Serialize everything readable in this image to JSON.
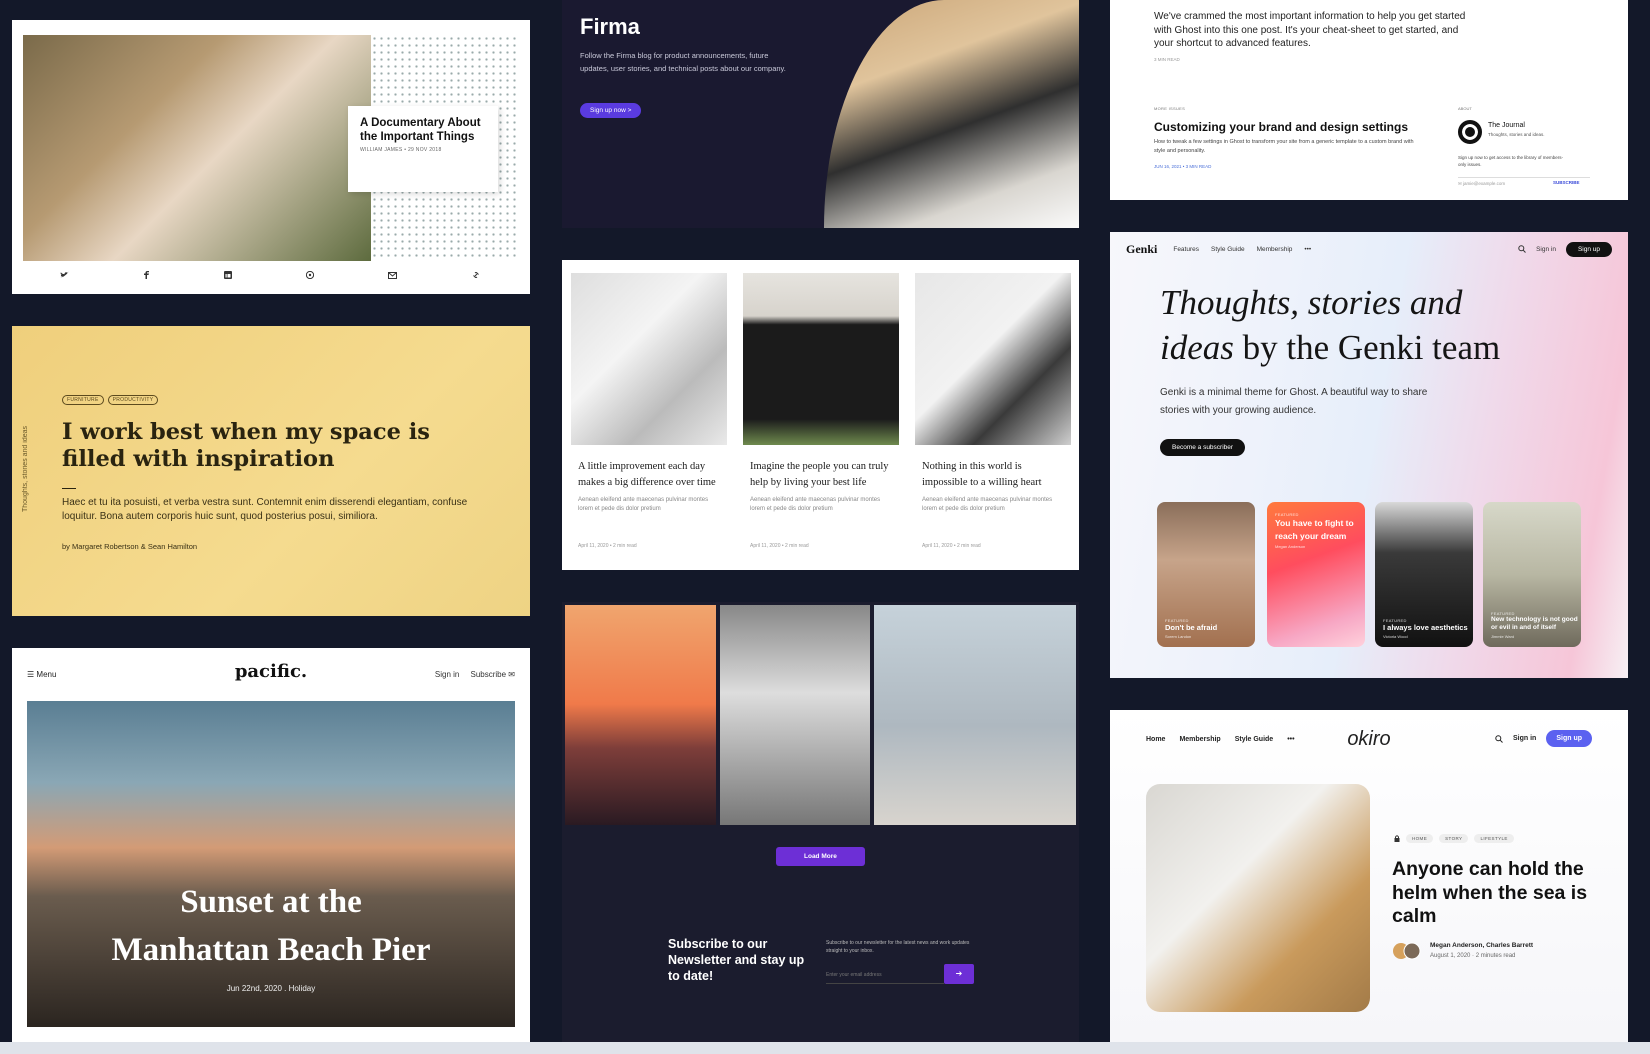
{
  "card1": {
    "title": "A Documentary About the Important Things",
    "meta": "WILLIAM JAMES • 29 NOV 2018",
    "share": [
      "twitter-icon",
      "facebook-icon",
      "linkedin-icon",
      "pinterest-icon",
      "email-icon",
      "link-icon"
    ]
  },
  "firma": {
    "brand": "Firma",
    "description": "Follow the Firma blog for product announcements, future updates, user stories, and technical posts about our company.",
    "button": "Sign up now >",
    "accent": "#5a3be0"
  },
  "card3": {
    "intro": "We've crammed the most important information to help you get started with Ghost into this one post. It's your cheat-sheet to get started, and your shortcut to advanced features.",
    "readtime": "3 MIN READ",
    "section": "MORE ISSUES",
    "heading": "Customizing your brand and design settings",
    "excerpt": "How to tweak a few settings in Ghost to transform your site from a generic template to a custom brand with style and personality.",
    "date": "JUN 16, 2021 • 3 MIN READ",
    "about_label": "ABOUT",
    "journal_title": "The Journal",
    "journal_sub": "Thoughts, stories and ideas.",
    "journal_pitch": "Sign up now to get access to the library of members-only issues.",
    "email_placeholder": "jamie@example.com",
    "subscribe": "SUBSCRIBE"
  },
  "card4": {
    "side_text": "Thoughts, stories and ideas",
    "tags": [
      "FURNITURE",
      "PRODUCTIVITY"
    ],
    "heading": "I work best when my space is filled with inspiration",
    "excerpt": "Haec et tu ita posuisti, et verba vestra sunt. Contemnit enim disserendi elegantiam, confuse loquitur. Bona autem corporis huic sunt, quod posterius posui, similiora.",
    "byline": "by Margaret Robertson & Sean Hamilton"
  },
  "card5": {
    "posts": [
      {
        "title": "A little improvement each day makes a big difference over time",
        "excerpt": "Aenean eleifend ante maecenas pulvinar montes lorem et pede dis dolor pretium",
        "meta": "April 11, 2020   •   2 min read"
      },
      {
        "title": "Imagine the people you can truly help by living your best life",
        "excerpt": "Aenean eleifend ante maecenas pulvinar montes lorem et pede dis dolor pretium",
        "meta": "April 11, 2020   •   2 min read"
      },
      {
        "title": "Nothing in this world is impossible to a willing heart",
        "excerpt": "Aenean eleifend ante maecenas pulvinar montes lorem et pede dis dolor pretium",
        "meta": "April 11, 2020   •   2 min read"
      }
    ]
  },
  "genki": {
    "logo": "Genki",
    "nav": [
      "Features",
      "Style Guide",
      "Membership",
      "•••"
    ],
    "signin": "Sign in",
    "signup": "Sign up",
    "heading_italic1": "Thoughts, stories and",
    "heading_italic2": "ideas",
    "heading_rest": " by the Genki team",
    "description": "Genki is a minimal theme for Ghost. A beautiful way to share stories with your growing audience.",
    "cta": "Become a subscriber",
    "tiles": [
      {
        "tag": "FEATURED",
        "title": "Don't be afraid",
        "author": "Sorem Landon"
      },
      {
        "tag": "FEATURED",
        "title": "You have to fight to reach your dream",
        "author": "Megan Anderson"
      },
      {
        "tag": "FEATURED",
        "title": "I always love aesthetics",
        "author": "Victoria Wood"
      },
      {
        "tag": "FEATURED",
        "title": "New technology is not good or evil in and of itself",
        "author": "Jimmie Ward"
      }
    ]
  },
  "pacific": {
    "menu": "Menu",
    "logo": "pacific.",
    "signin": "Sign in",
    "subscribe": "Subscribe",
    "heading_line1": "Sunset at the",
    "heading_line2": "Manhattan Beach Pier",
    "meta": "Jun 22nd, 2020  .  Holiday"
  },
  "gallery": {
    "load_more": "Load More",
    "newsletter_heading": "Subscribe to our Newsletter and stay up to date!",
    "newsletter_desc": "Subscribe to our newsletter for the latest news and work updates straight to your inbox.",
    "email_placeholder": "Enter your email address",
    "submit_icon": "arrow-right-icon",
    "accent": "#6d2fd6"
  },
  "okiro": {
    "nav": [
      "Home",
      "Membership",
      "Style Guide",
      "•••"
    ],
    "logo": "okiro",
    "signin": "Sign in",
    "signup": "Sign up",
    "tags": [
      "HOME",
      "STORY",
      "LIFESTYLE"
    ],
    "heading": "Anyone can hold the helm when the sea is calm",
    "authors": "Megan Anderson, Charles Barrett",
    "date": "August 1, 2020 · 2 minutes read",
    "accent": "#5b61f0"
  }
}
